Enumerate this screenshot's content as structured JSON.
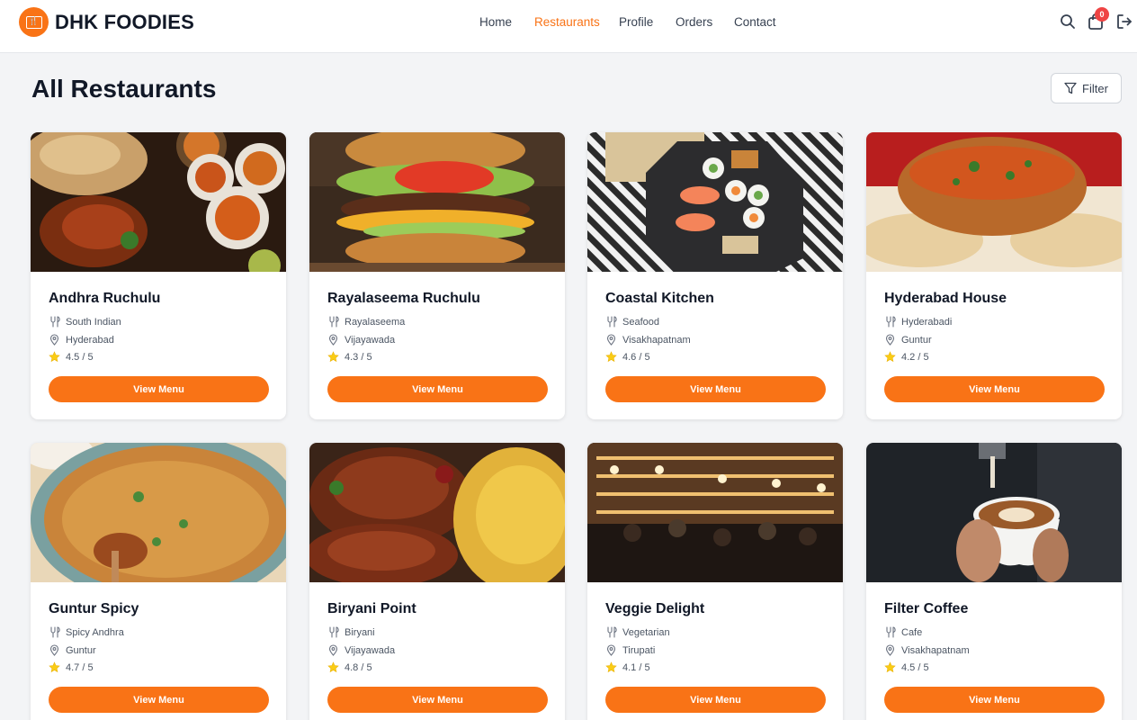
{
  "brand": {
    "name": "DHK FOODIES",
    "logo_icon": "restaurant-icon",
    "accent": "#f97316"
  },
  "nav": [
    {
      "label": "Home",
      "active": false
    },
    {
      "label": "Restaurants",
      "active": true
    },
    {
      "label": "Profile",
      "active": false
    },
    {
      "label": "Orders",
      "active": false
    },
    {
      "label": "Contact",
      "active": false
    }
  ],
  "header_actions": {
    "search_icon": "search-icon",
    "cart_icon": "shopping-bag-icon",
    "cart_count": "0",
    "logout_icon": "logout-icon"
  },
  "page": {
    "title": "All Restaurants",
    "filter_label": "Filter"
  },
  "restaurants": [
    {
      "name": "Andhra Ruchulu",
      "cuisine": "South Indian",
      "city": "Hyderabad",
      "rating": "4.5 / 5",
      "button": "View Menu"
    },
    {
      "name": "Rayalaseema Ruchulu",
      "cuisine": "Rayalaseema",
      "city": "Vijayawada",
      "rating": "4.3 / 5",
      "button": "View Menu"
    },
    {
      "name": "Coastal Kitchen",
      "cuisine": "Seafood",
      "city": "Visakhapatnam",
      "rating": "4.6 / 5",
      "button": "View Menu"
    },
    {
      "name": "Hyderabad House",
      "cuisine": "Hyderabadi",
      "city": "Guntur",
      "rating": "4.2 / 5",
      "button": "View Menu"
    },
    {
      "name": "Guntur Spicy",
      "cuisine": "Spicy Andhra",
      "city": "Guntur",
      "rating": "4.7 / 5",
      "button": "View Menu"
    },
    {
      "name": "Biryani Point",
      "cuisine": "Biryani",
      "city": "Vijayawada",
      "rating": "4.8 / 5",
      "button": "View Menu"
    },
    {
      "name": "Veggie Delight",
      "cuisine": "Vegetarian",
      "city": "Tirupati",
      "rating": "4.1 / 5",
      "button": "View Menu"
    },
    {
      "name": "Filter Coffee",
      "cuisine": "Cafe",
      "city": "Visakhapatnam",
      "rating": "4.5 / 5",
      "button": "View Menu"
    }
  ]
}
